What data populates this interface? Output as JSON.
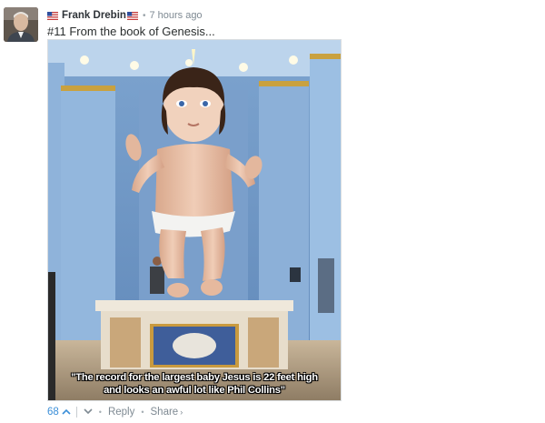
{
  "comment": {
    "author": "Frank Drebin",
    "timestamp": "7 hours ago",
    "message": "#11 From the book of Genesis...",
    "image_caption_line1": "\"The record for the largest baby Jesus is 22 feet high",
    "image_caption_line2": "and looks an awful lot like Phil Collins\"",
    "votes": "68",
    "reply_label": "Reply",
    "share_label": "Share"
  },
  "icons": {
    "flag": "us-flag-icon",
    "upvote": "chevron-up-icon",
    "downvote": "chevron-down-icon",
    "share_chevron": "chevron-right-icon"
  },
  "colors": {
    "link_blue": "#3b8fd8",
    "meta_gray": "#7f8a93",
    "author": "#2e3338"
  }
}
